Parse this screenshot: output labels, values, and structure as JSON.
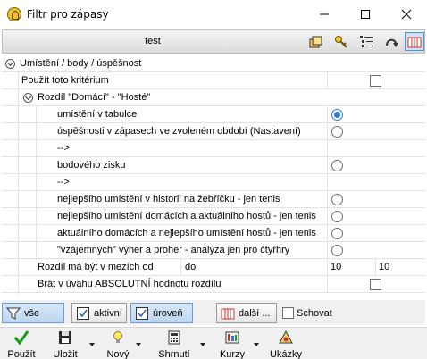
{
  "window": {
    "title": "Filtr pro zápasy"
  },
  "topbar": {
    "title": "test"
  },
  "tree": {
    "group_label": "Umístění / body / úspěšnost",
    "use_criterion_label": "Použít toto kritérium",
    "subgroup_label": "Rozdíl \"Domácí\" - \"Hosté\"",
    "options": [
      {
        "label": "umístění v tabulce",
        "selected": true
      },
      {
        "label": "úspěšnosti v zápasech ve zvoleném období (Nastavení)",
        "selected": false
      },
      {
        "label": "-->",
        "selected": null
      },
      {
        "label": "bodového zisku",
        "selected": false
      },
      {
        "label": "-->",
        "selected": null
      },
      {
        "label": "nejlepšího umístění v historii na žebříčku - jen tenis",
        "selected": false
      },
      {
        "label": "nejlepšího umístění domácích a aktuálního hostů - jen tenis",
        "selected": false
      },
      {
        "label": "aktuálního domácích a nejlepšího umístění hostů - jen tenis",
        "selected": false
      },
      {
        "label": "\"vzájemných\" výher a proher - analýza jen pro čtyřhry",
        "selected": false
      }
    ],
    "range_label": "Rozdíl má být v mezích od",
    "range_to_label": "do",
    "range_from_value": "10",
    "range_to_value": "10",
    "absolute_label": "Brát v úvahu ABSOLUTNÍ hodnotu rozdílu"
  },
  "filterbar": {
    "all_label": "vše",
    "active_label": "aktivní",
    "level_label": "úroveň",
    "more_label": "další ...",
    "show_label": "Schovat"
  },
  "actions": {
    "use_label": "Použít",
    "save_label": "Uložit",
    "new_label": "Nový",
    "summary_label": "Shrnutí",
    "odds_label": "Kurzy",
    "examples_label": "Ukázky"
  },
  "colors": {
    "accent": "#2b79d8",
    "pressed_bg": "#cfe3f7"
  }
}
